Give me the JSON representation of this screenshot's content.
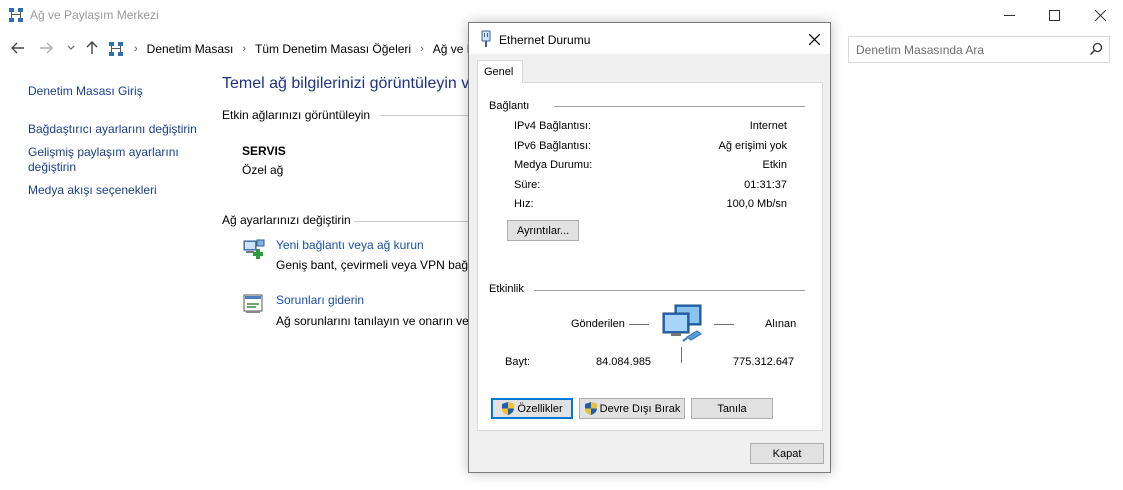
{
  "window": {
    "title": "Ağ ve Paylaşım Merkezi"
  },
  "address": {
    "crumbs": [
      "Denetim Masası",
      "Tüm Denetim Masası Öğeleri",
      "Ağ ve Pa"
    ]
  },
  "search": {
    "placeholder": "Denetim Masasında Ara"
  },
  "sidebar": {
    "items": [
      {
        "label": "Denetim Masası Giriş"
      },
      {
        "label": "Bağdaştırıcı ayarlarını değiştirin"
      },
      {
        "label": "Gelişmiş paylaşım ayarlarını değiştirin"
      },
      {
        "label": "Medya akışı seçenekleri"
      }
    ]
  },
  "main": {
    "heading": "Temel ağ bilgilerinizi görüntüleyin v",
    "active_label": "Etkin ağlarınızı görüntüleyin",
    "network_name": "SERVIS",
    "network_type": "Özel ağ",
    "change_label": "Ağ ayarlarınızı değiştirin",
    "tasks": [
      {
        "link": "Yeni bağlantı veya ağ kurun",
        "desc": "Geniş bant, çevirmeli veya VPN bağla"
      },
      {
        "link": "Sorunları giderin",
        "desc": "Ağ sorunlarını tanılayın ve onarın vey"
      }
    ]
  },
  "dialog": {
    "title": "Ethernet Durumu",
    "tab": "Genel",
    "connection": {
      "label": "Bağlantı",
      "rows": [
        {
          "label": "IPv4 Bağlantısı:",
          "value": "Internet"
        },
        {
          "label": "IPv6 Bağlantısı:",
          "value": "Ağ erişimi yok"
        },
        {
          "label": "Medya Durumu:",
          "value": "Etkin"
        },
        {
          "label": "Süre:",
          "value": "01:31:37"
        },
        {
          "label": "Hız:",
          "value": "100,0 Mb/sn"
        }
      ],
      "details_button": "Ayrıntılar..."
    },
    "activity": {
      "label": "Etkinlik",
      "sent_label": "Gönderilen",
      "received_label": "Alınan",
      "bytes_label": "Bayt:",
      "sent_bytes": "84.084.985",
      "received_bytes": "775.312.647"
    },
    "buttons": {
      "properties": "Özellikler",
      "disable": "Devre Dışı Bırak",
      "diagnose": "Tanıla",
      "close": "Kapat"
    }
  }
}
